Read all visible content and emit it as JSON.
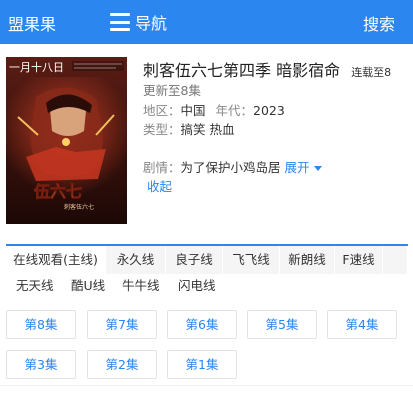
{
  "header": {
    "brand": "盟果果",
    "nav_label": "导航",
    "search_label": "搜索",
    "accent": "#2b86f0"
  },
  "movie": {
    "title": "刺客伍六七第四季 暗影宿命",
    "status_badge": "连载至8",
    "update": "更新至8集",
    "region_label": "地区：",
    "region": "中国",
    "year_label": "年代：",
    "year": "2023",
    "type_label": "类型：",
    "type": "搞笑 热血",
    "plot_label": "剧情：",
    "plot": "为了保护小鸡岛居",
    "expand_label": "展开",
    "collapse_label": "收起",
    "poster": {
      "date_text": "一月十八日",
      "logo_text": "伍六七",
      "logo_sub": "刺客伍六七"
    }
  },
  "sources": {
    "row1": [
      "在线观看(主线)",
      "永久线",
      "良子线",
      "飞飞线",
      "新朗线",
      "F速线"
    ],
    "row2": [
      "无天线",
      "酷U线",
      "牛牛线",
      "闪电线"
    ],
    "active": "在线观看(主线)"
  },
  "episodes": [
    "第8集",
    "第7集",
    "第6集",
    "第5集",
    "第4集",
    "第3集",
    "第2集",
    "第1集"
  ]
}
